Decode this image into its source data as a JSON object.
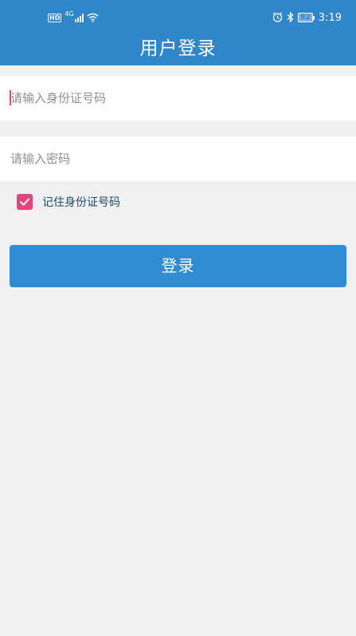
{
  "status_bar": {
    "hd_badge": "HD",
    "network_type": "4G",
    "battery": "82",
    "time": "3:19",
    "icons": [
      "signal-icon",
      "wifi-icon",
      "alarm-icon",
      "bluetooth-icon",
      "battery-icon"
    ]
  },
  "header": {
    "title": "用户登录"
  },
  "form": {
    "id_number_placeholder": "请输入身份证号码",
    "password_placeholder": "请输入密码",
    "remember_label": "记住身份证号码",
    "remember_checked": true,
    "login_label": "登录"
  },
  "colors": {
    "primary": "#2f86c9",
    "button": "#2f8cd3",
    "accent": "#e2457f",
    "background": "#f0f0f0"
  }
}
